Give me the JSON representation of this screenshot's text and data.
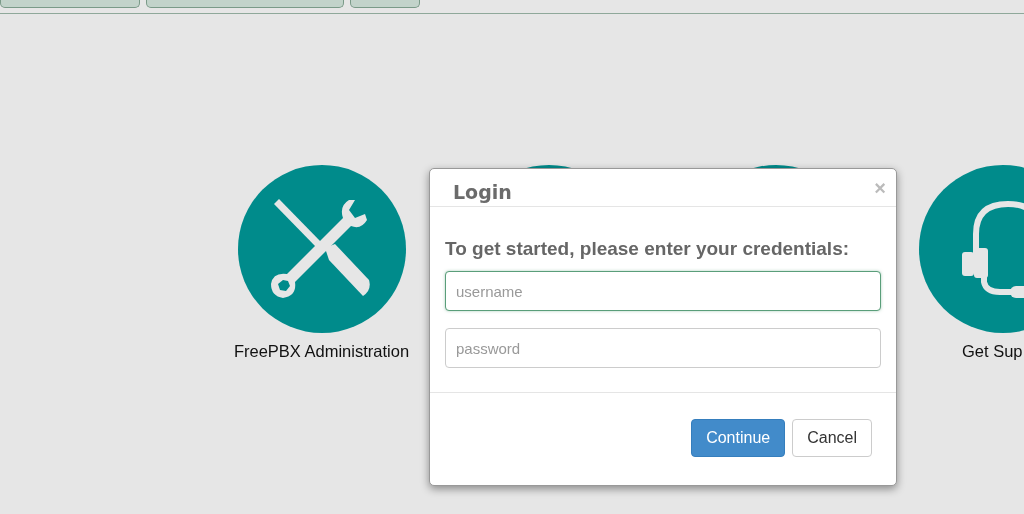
{
  "top_tabs": [
    {
      "kind": "tab"
    },
    {
      "kind": "tab"
    },
    {
      "kind": "tab"
    }
  ],
  "apps": [
    {
      "kind": "tools",
      "label": "FreePBX Administration"
    },
    {
      "kind": "blank"
    },
    {
      "kind": "blank"
    },
    {
      "kind": "headset",
      "label": "Get Sup"
    }
  ],
  "modal": {
    "title": "Login",
    "close": "×",
    "prompt": "To get started, please enter your credentials:",
    "fields": [
      {
        "placeholder": "username",
        "focused": true
      },
      {
        "placeholder": "password",
        "focused": false
      }
    ],
    "buttons": [
      {
        "label": "Continue",
        "kind": "primary"
      },
      {
        "label": "Cancel",
        "kind": "default"
      }
    ]
  }
}
